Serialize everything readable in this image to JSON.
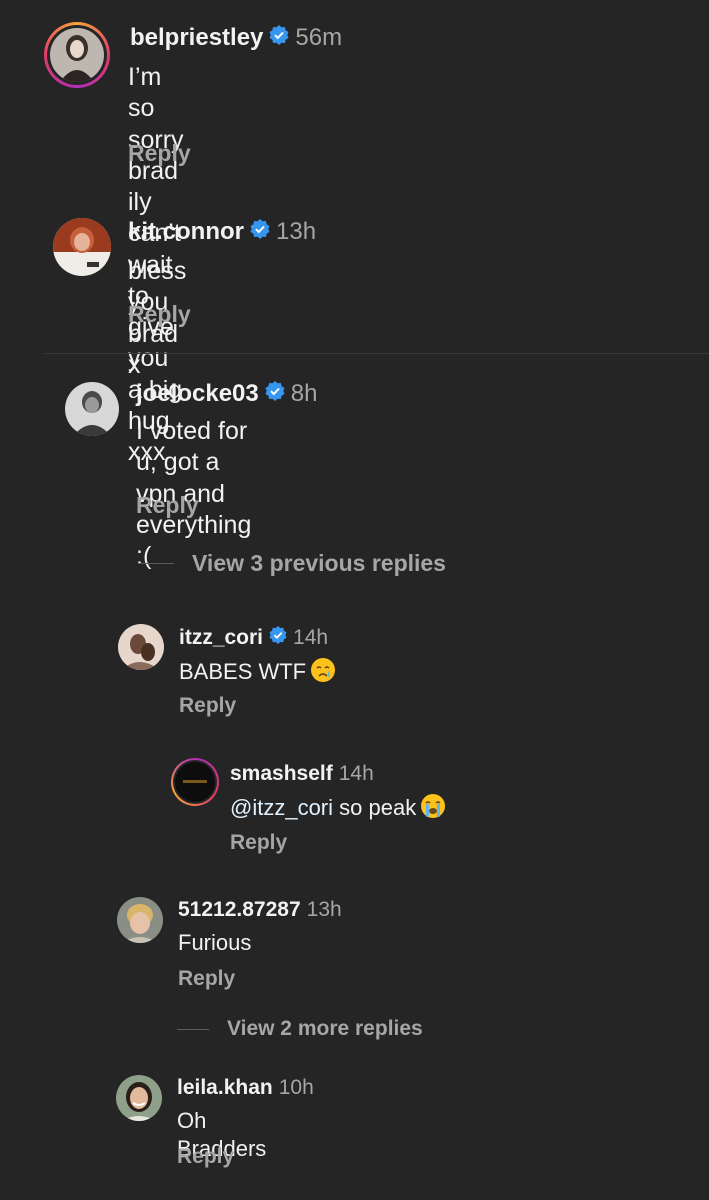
{
  "comments": [
    {
      "username": "belpriestley",
      "verified": true,
      "time": "56m",
      "text_line1": "I’m so sorry brad ily can’t wait to",
      "text_line2": "give you a big hug xxx",
      "reply_label": "Reply"
    },
    {
      "username": "kit.connor",
      "verified": true,
      "time": "13h",
      "text_line1": "bless you brad x",
      "reply_label": "Reply"
    },
    {
      "username": "joelocke03",
      "verified": true,
      "time": "8h",
      "text_line1": "I voted for u, got a vpn and",
      "text_line2": "everything :(",
      "reply_label": "Reply"
    }
  ],
  "view_previous_replies": "View 3 previous replies",
  "replies": [
    {
      "username": "itzz_cori",
      "verified": true,
      "time": "14h",
      "text": "BABES WTF",
      "reply_label": "Reply"
    },
    {
      "username": "smashself",
      "verified": false,
      "time": "14h",
      "mention": "@itzz_cori",
      "text": "so peak",
      "reply_label": "Reply"
    },
    {
      "username": "51212.87287",
      "verified": false,
      "time": "13h",
      "text": "Furious",
      "reply_label": "Reply"
    }
  ],
  "view_more_replies": "View 2 more replies",
  "last_comment": {
    "username": "leila.khan",
    "verified": false,
    "time": "10h",
    "text": "Oh Bradders",
    "reply_label": "Reply"
  },
  "colors": {
    "background": "#252525",
    "verified_blue": "#3797f0",
    "secondary_text": "#a6a6a6"
  }
}
